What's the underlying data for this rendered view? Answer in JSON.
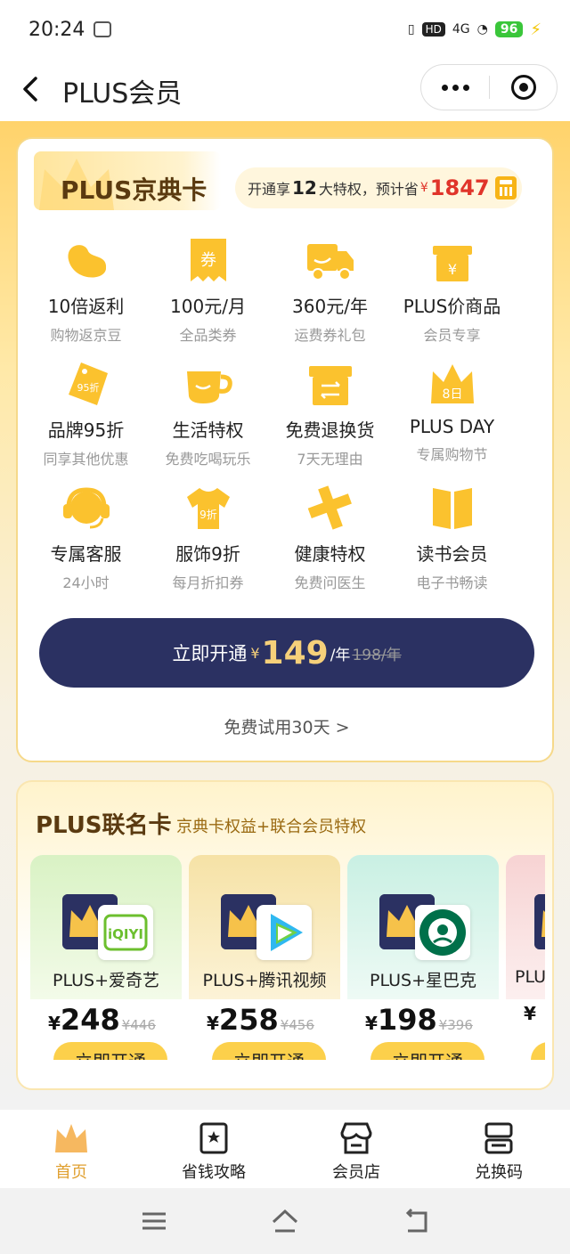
{
  "status_bar": {
    "time": "20:24",
    "network": "4G",
    "hd": "HD",
    "battery": "96"
  },
  "nav": {
    "title": "PLUS会员"
  },
  "plus_card": {
    "title": "PLUS京典卡",
    "savings_prefix": "开通享",
    "savings_count": "12",
    "savings_mid": "大特权，预计省",
    "savings_yen": "¥",
    "savings_amount": "1847",
    "benefits": [
      {
        "icon": "bean-icon",
        "title": "10倍返利",
        "sub": "购物返京豆"
      },
      {
        "icon": "coupon-icon",
        "title": "100元/月",
        "sub": "全品类券"
      },
      {
        "icon": "truck-icon",
        "title": "360元/年",
        "sub": "运费券礼包"
      },
      {
        "icon": "gift-box-icon",
        "title": "PLUS价商品",
        "sub": "会员专享"
      },
      {
        "icon": "discount-tag-icon",
        "title": "品牌95折",
        "sub": "同享其他优惠"
      },
      {
        "icon": "cup-icon",
        "title": "生活特权",
        "sub": "免费吃喝玩乐"
      },
      {
        "icon": "return-box-icon",
        "title": "免费退换货",
        "sub": "7天无理由"
      },
      {
        "icon": "crown-day-icon",
        "title": "PLUS DAY",
        "sub": "专属购物节"
      },
      {
        "icon": "headset-icon",
        "title": "专属客服",
        "sub": "24小时"
      },
      {
        "icon": "tshirt-icon",
        "title": "服饰9折",
        "sub": "每月折扣券"
      },
      {
        "icon": "health-cross-icon",
        "title": "健康特权",
        "sub": "免费问医生"
      },
      {
        "icon": "book-icon",
        "title": "读书会员",
        "sub": "电子书畅读"
      }
    ],
    "open_button": {
      "label": "立即开通",
      "yen": "¥",
      "price": "149",
      "unit": "/年",
      "original": "198/年"
    },
    "trial_link": "免费试用30天 >"
  },
  "joint": {
    "title": "PLUS联名卡",
    "subtitle": "京典卡权益+联合会员特权",
    "cards": [
      {
        "name": "PLUS+爱奇艺",
        "partner_icon": "iqiyi-logo-icon",
        "yen": "¥",
        "price": "248",
        "original": "¥446",
        "button": "立即开通",
        "bg": "#d9f2c4"
      },
      {
        "name": "PLUS+腾讯视频",
        "partner_icon": "tencent-video-logo-icon",
        "yen": "¥",
        "price": "258",
        "original": "¥456",
        "button": "立即开通",
        "bg": "#f6e2a6"
      },
      {
        "name": "PLUS+星巴克",
        "partner_icon": "starbucks-logo-icon",
        "yen": "¥",
        "price": "198",
        "original": "¥396",
        "button": "立即开通",
        "bg": "#c9f0e3"
      },
      {
        "name": "PLU",
        "partner_icon": "partner-logo-icon",
        "yen": "¥",
        "price": "",
        "original": "",
        "button": "",
        "bg": "#f7d3d3"
      }
    ]
  },
  "tabs": [
    {
      "label": "首页",
      "icon": "crown-icon",
      "active": true
    },
    {
      "label": "省钱攻略",
      "icon": "guide-book-icon",
      "active": false
    },
    {
      "label": "会员店",
      "icon": "store-icon",
      "active": false
    },
    {
      "label": "兑换码",
      "icon": "ticket-icon",
      "active": false
    }
  ],
  "colors": {
    "gold": "#ffd36b",
    "navy": "#2b3162",
    "price_red": "#e0342a",
    "accent": "#e0a030",
    "button_yellow": "#fcd04b"
  }
}
